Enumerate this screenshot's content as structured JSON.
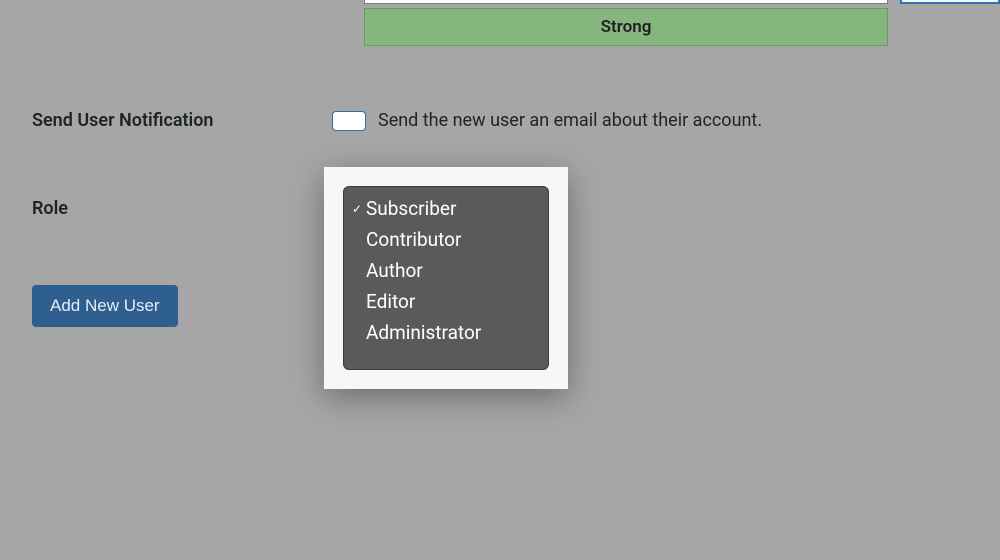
{
  "password": {
    "strength_label": "Strong"
  },
  "notification": {
    "row_label": "Send User Notification",
    "checked": true,
    "description": "Send the new user an email about their account."
  },
  "role": {
    "row_label": "Role",
    "selected": "Subscriber",
    "options": [
      "Subscriber",
      "Contributor",
      "Author",
      "Editor",
      "Administrator"
    ]
  },
  "submit": {
    "label": "Add New User"
  }
}
